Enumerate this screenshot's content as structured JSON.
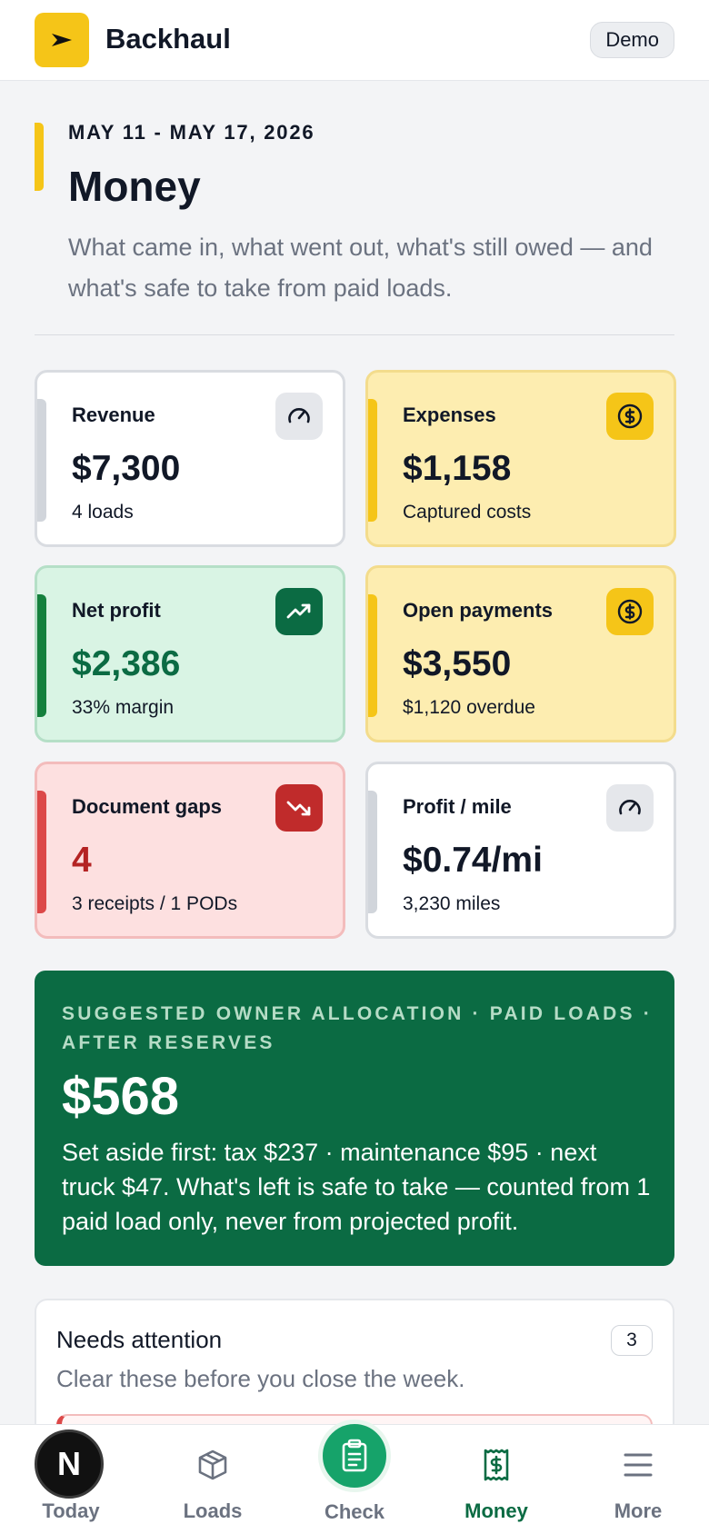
{
  "app": {
    "brand": "Backhaul",
    "mode_badge": "Demo"
  },
  "page": {
    "date_range": "MAY 11 - MAY 17, 2026",
    "title": "Money",
    "subtitle": "What came in, what went out, what's still owed — and what's safe to take from paid loads."
  },
  "kpis": {
    "revenue": {
      "label": "Revenue",
      "value": "$7,300",
      "note": "4 loads",
      "icon": "gauge-icon"
    },
    "expenses": {
      "label": "Expenses",
      "value": "$1,158",
      "note": "Captured costs",
      "icon": "dollar-circle-icon"
    },
    "net_profit": {
      "label": "Net profit",
      "value": "$2,386",
      "note": "33% margin",
      "icon": "trend-up-icon"
    },
    "open_payments": {
      "label": "Open payments",
      "value": "$3,550",
      "note": "$1,120 overdue",
      "icon": "dollar-circle-icon"
    },
    "document_gaps": {
      "label": "Document gaps",
      "value": "4",
      "note": "3 receipts / 1 PODs",
      "icon": "trend-down-icon"
    },
    "profit_per_mile": {
      "label": "Profit / mile",
      "value": "$0.74/mi",
      "note": "3,230 miles",
      "icon": "gauge-icon"
    }
  },
  "allocation": {
    "eyebrow": "SUGGESTED OWNER ALLOCATION · PAID LOADS · AFTER RESERVES",
    "amount": "$568",
    "description": "Set aside first: tax $237 · maintenance $95 · next truck $47. What's left is safe to take — counted from 1 paid load only, never from projected profit."
  },
  "attention": {
    "title": "Needs attention",
    "subtitle": "Clear these before you close the week.",
    "count": "3"
  },
  "nav": {
    "today": "Today",
    "loads": "Loads",
    "check": "Check",
    "money": "Money",
    "more": "More",
    "dev_badge": "N"
  },
  "colors": {
    "brand_yellow": "#f5c518",
    "profit_green": "#0b6b43",
    "alert_red": "#c02b2b"
  }
}
